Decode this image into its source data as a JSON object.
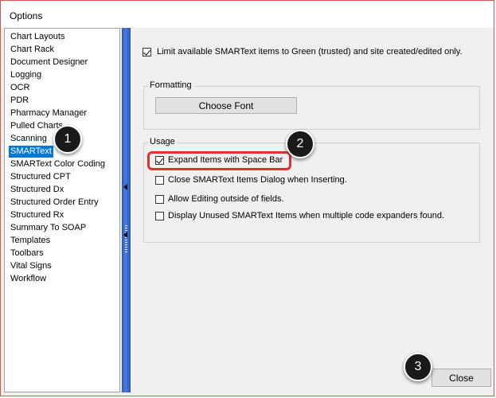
{
  "window": {
    "title": "Options"
  },
  "sidebar": {
    "items": [
      {
        "label": "Chart Layouts"
      },
      {
        "label": "Chart Rack"
      },
      {
        "label": "Document Designer"
      },
      {
        "label": "Logging"
      },
      {
        "label": "OCR"
      },
      {
        "label": "PDR"
      },
      {
        "label": "Pharmacy Manager"
      },
      {
        "label": "Pulled Charts"
      },
      {
        "label": "Scanning"
      },
      {
        "label": "SMARText",
        "selected": true
      },
      {
        "label": "SMARText Color Coding"
      },
      {
        "label": "Structured CPT"
      },
      {
        "label": "Structured Dx"
      },
      {
        "label": "Structured Order Entry"
      },
      {
        "label": "Structured Rx"
      },
      {
        "label": "Summary To SOAP"
      },
      {
        "label": "Templates"
      },
      {
        "label": "Toolbars"
      },
      {
        "label": "Vital Signs"
      },
      {
        "label": "Workflow"
      }
    ]
  },
  "main": {
    "limit_option": {
      "label": "Limit available SMARText items to Green (trusted) and site created/edited only.",
      "checked": true
    },
    "formatting": {
      "legend": "Formatting",
      "choose_font_label": "Choose Font"
    },
    "usage": {
      "legend": "Usage",
      "options": [
        {
          "label": "Expand Items with Space Bar",
          "checked": true
        },
        {
          "label": "Close SMARText Items Dialog when Inserting.",
          "checked": false
        },
        {
          "label": "Allow Editing outside of fields.",
          "checked": false
        },
        {
          "label": "Display Unused SMARText Items when multiple code expanders found.",
          "checked": false
        }
      ]
    },
    "close_label": "Close"
  },
  "annotations": {
    "badge1": "1",
    "badge2": "2",
    "badge3": "3"
  },
  "colors": {
    "selection": "#0078d7",
    "splitter": "#2755b8",
    "highlight": "#e03030",
    "window_border": "#d9534f"
  }
}
